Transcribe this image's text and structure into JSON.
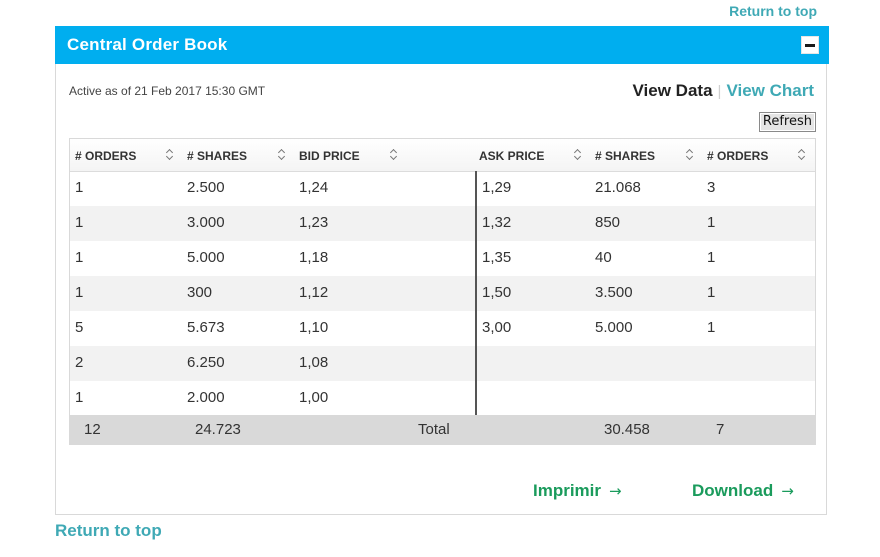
{
  "links": {
    "return_to_top_top": "Return to top",
    "return_to_top_bottom": "Return to top"
  },
  "panel": {
    "title": "Central Order Book",
    "active_as_of": "Active as of 21 Feb 2017 15:30 GMT",
    "view_data": "View Data",
    "view_chart": "View Chart",
    "separator": "|",
    "refresh": "Refresh"
  },
  "colors": {
    "header": "#00aeef",
    "teal_link": "#3fa9b5",
    "green_action": "#1a9b5c",
    "totals_row": "#d9d9d9"
  },
  "table": {
    "headers": [
      "# ORDERS",
      "# SHARES",
      "BID PRICE",
      "ASK PRICE",
      "# SHARES",
      "# ORDERS"
    ],
    "rows": [
      [
        "1",
        "2.500",
        "1,24",
        "1,29",
        "21.068",
        "3"
      ],
      [
        "1",
        "3.000",
        "1,23",
        "1,32",
        "850",
        "1"
      ],
      [
        "1",
        "5.000",
        "1,18",
        "1,35",
        "40",
        "1"
      ],
      [
        "1",
        "300",
        "1,12",
        "1,50",
        "3.500",
        "1"
      ],
      [
        "5",
        "5.673",
        "1,10",
        "3,00",
        "5.000",
        "1"
      ],
      [
        "2",
        "6.250",
        "1,08",
        "",
        "",
        ""
      ],
      [
        "1",
        "2.000",
        "1,00",
        "",
        "",
        ""
      ]
    ],
    "totals": {
      "bid_orders": "12",
      "bid_shares": "24.723",
      "label": "Total",
      "ask_shares": "30.458",
      "ask_orders": "7"
    }
  },
  "actions": {
    "print": "Imprimir",
    "download": "Download"
  }
}
